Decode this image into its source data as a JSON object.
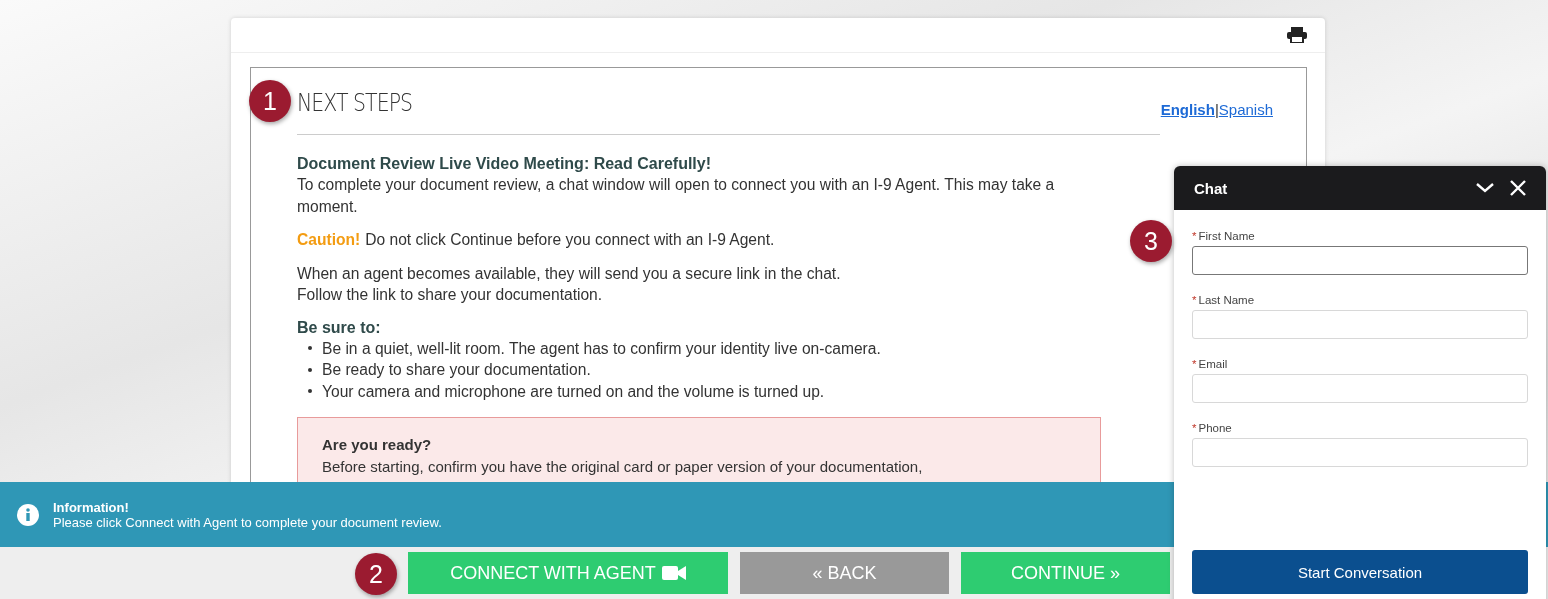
{
  "card": {
    "heading": "NEXT STEPS",
    "languages": [
      {
        "label": "English",
        "selected": true
      },
      {
        "label": "Spanish",
        "selected": false
      }
    ],
    "language_separator": "|",
    "section_title": "Document Review Live Video Meeting: Read Carefully!",
    "intro": "To complete your document review, a chat window will open to connect you with an I-9 Agent. This may take a moment.",
    "caution_label": "Caution!",
    "caution_text": "Do not click Continue before you connect with an I-9 Agent.",
    "agent_lines": [
      "When an agent becomes available, they will send you a secure link in the chat.",
      "Follow the link to share your documentation."
    ],
    "checklist_title": "Be sure to:",
    "checklist": [
      "Be in a quiet, well-lit room. The agent has to confirm your identity live on-camera.",
      "Be ready to share your documentation.",
      "Your camera and microphone are turned on and the volume is turned up."
    ],
    "alert": {
      "title": "Are you ready?",
      "text": "Before starting, confirm you have the original card or paper version of your documentation,"
    }
  },
  "info_bar": {
    "title": "Information!",
    "message": "Please click Connect with Agent to complete your document review."
  },
  "buttons": [
    {
      "label": "CONNECT WITH AGENT",
      "kind": "connect"
    },
    {
      "label": "« BACK",
      "kind": "back"
    },
    {
      "label": "CONTINUE »",
      "kind": "continue"
    }
  ],
  "chat": {
    "title": "Chat",
    "fields": [
      {
        "label": "First Name",
        "required_mark": "*",
        "focused": true
      },
      {
        "label": "Last Name",
        "required_mark": "*",
        "focused": false
      },
      {
        "label": "Email",
        "required_mark": "*",
        "focused": false
      },
      {
        "label": "Phone",
        "required_mark": "*",
        "focused": false
      }
    ],
    "submit": "Start Conversation"
  },
  "callouts": [
    {
      "number": "1"
    },
    {
      "number": "2"
    },
    {
      "number": "3"
    }
  ]
}
